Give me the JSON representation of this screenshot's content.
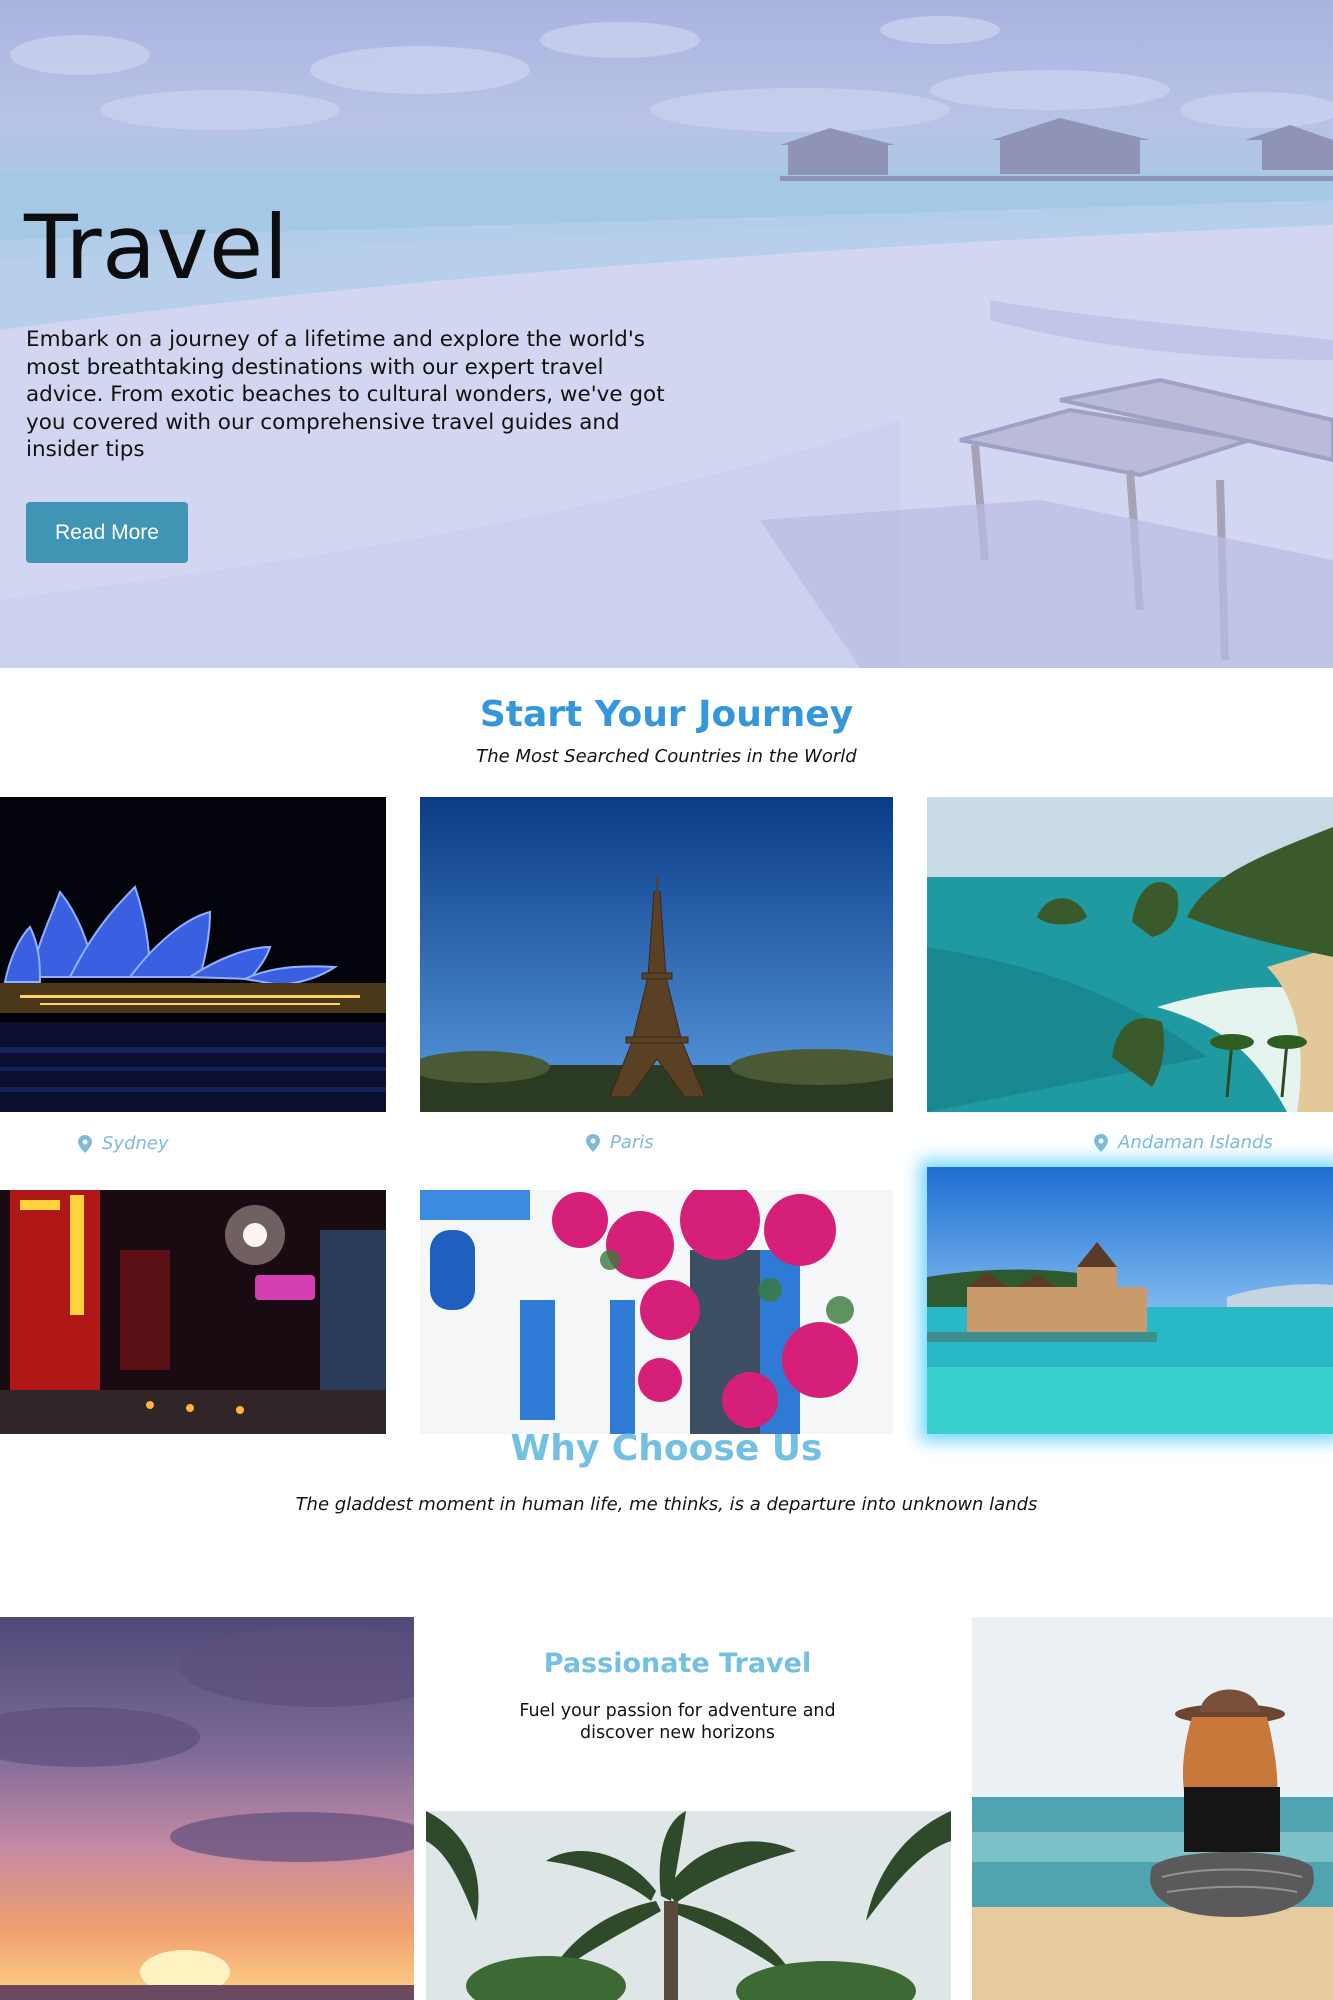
{
  "hero": {
    "title": "Travel",
    "description": "Embark on a journey of a lifetime and explore the world's most breathtaking destinations with our expert travel advice. From exotic beaches to cultural wonders, we've got you covered with our comprehensive travel guides and insider tips",
    "button_label": "Read More"
  },
  "journey": {
    "title": "Start Your Journey",
    "subtitle": "The Most Searched Countries in the World",
    "destinations": [
      {
        "label": "Sydney",
        "icon": "map-pin-icon"
      },
      {
        "label": "Paris",
        "icon": "map-pin-icon"
      },
      {
        "label": "Andaman Islands",
        "icon": "map-pin-icon"
      }
    ]
  },
  "why": {
    "title": "Why Choose Us",
    "quote": "The gladdest moment in human life, me thinks, is a departure into unknown lands",
    "feature_title": "Passionate Travel",
    "feature_text": "Fuel your passion for adventure and discover new horizons"
  },
  "colors": {
    "accent_blue": "#3497db",
    "accent_light_blue": "#73c0e3",
    "button_teal": "#3f95b3",
    "caption_blue": "#7fbadc"
  }
}
